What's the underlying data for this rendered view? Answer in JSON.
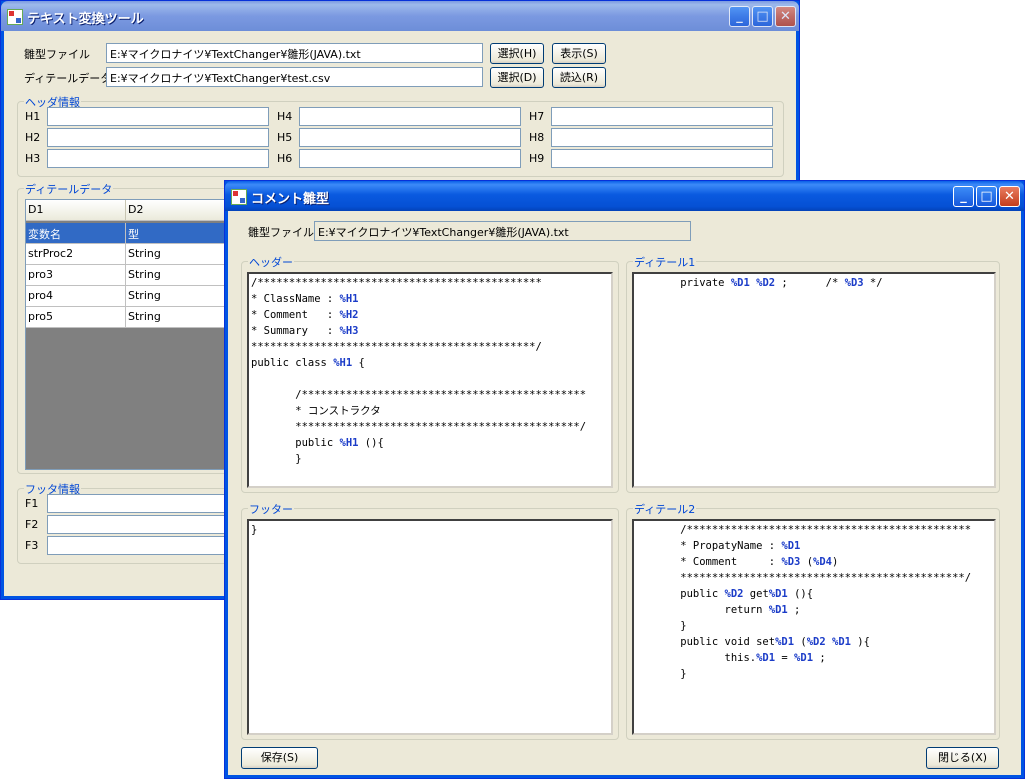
{
  "main_window": {
    "title": "テキスト変換ツール",
    "template_file_label": "雛型ファイル",
    "template_file_value": "E:¥マイクロナイツ¥TextChanger¥雛形(JAVA).txt",
    "detail_data_label": "ディテールデータ",
    "detail_data_value": "E:¥マイクロナイツ¥TextChanger¥test.csv",
    "select_button_1": "選択(H)",
    "show_button": "表示(S)",
    "select_button_2": "選択(D)",
    "load_button": "読込(R)",
    "header_group_title": "ヘッダ情報",
    "header_fields": [
      "H1",
      "H2",
      "H3",
      "H4",
      "H5",
      "H6",
      "H7",
      "H8",
      "H9"
    ],
    "detail_group_title": "ディテールデータ",
    "grid": {
      "columns": [
        "D1",
        "D2"
      ],
      "rows": [
        [
          "変数名",
          "型"
        ],
        [
          "strProc2",
          "String"
        ],
        [
          "pro3",
          "String"
        ],
        [
          "pro4",
          "String"
        ],
        [
          "pro5",
          "String"
        ]
      ]
    },
    "footer_group_title": "フッタ情報",
    "footer_fields": [
      "F1",
      "F2",
      "F3"
    ]
  },
  "comment_window": {
    "title": "コメント雛型",
    "template_file_label": "雛型ファイル",
    "template_file_value": "E:¥マイクロナイツ¥TextChanger¥雛形(JAVA).txt",
    "header_title": "ヘッダー",
    "detail1_title": "ディテール1",
    "footer_title": "フッター",
    "detail2_title": "ディテール2",
    "header_code": [
      "/*********************************************",
      "* ClassName : %H1",
      "* Comment   : %H2",
      "* Summary   : %H3",
      "*********************************************/",
      "public class %H1 {",
      "",
      "       /*********************************************",
      "       * コンストラクタ",
      "       *********************************************/",
      "       public %H1 (){",
      "       }"
    ],
    "detail1_code": [
      "       private %D1 %D2 ;      /* %D3 */"
    ],
    "footer_code": [
      "}"
    ],
    "detail2_code": [
      "       /*********************************************",
      "       * PropatyName : %D1",
      "       * Comment     : %D3 (%D4)",
      "       *********************************************/",
      "       public %D2 get%D1 (){",
      "              return %D1 ;",
      "       }",
      "       public void set%D1 (%D2 %D1 ){",
      "              this.%D1 = %D1 ;",
      "       }"
    ],
    "save_button": "保存(S)",
    "close_button": "閉じる(X)"
  }
}
